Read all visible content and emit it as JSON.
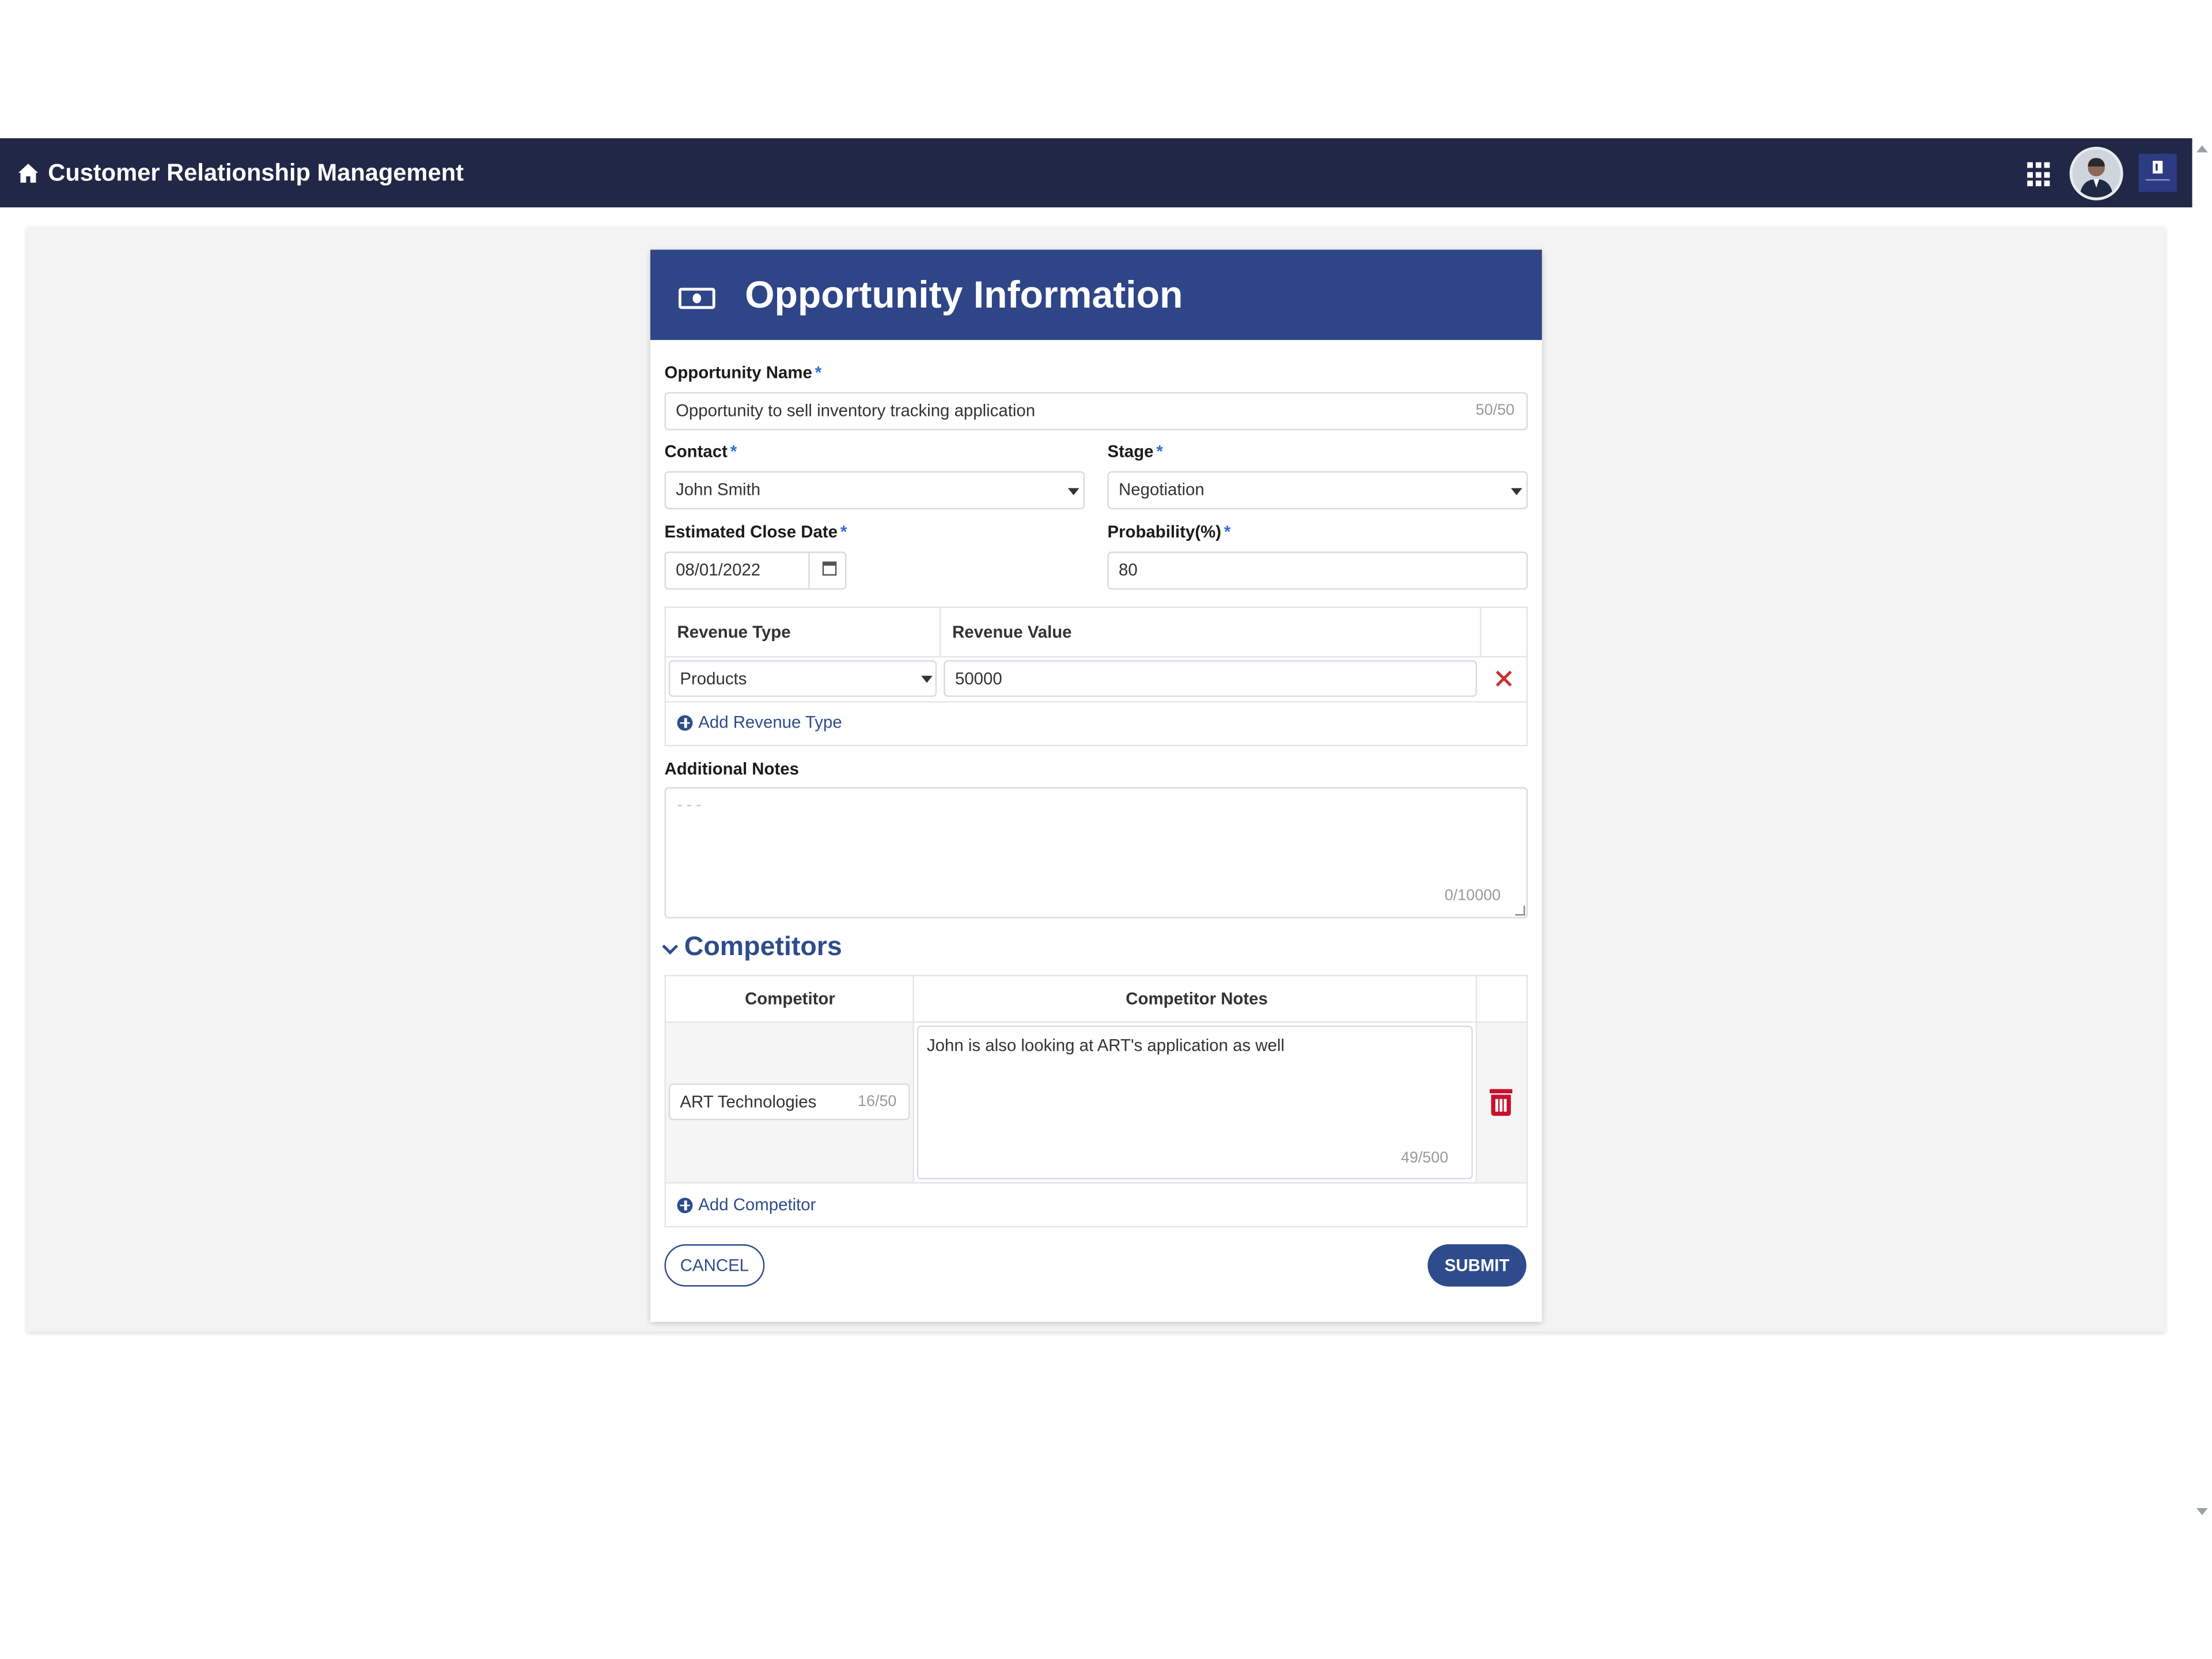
{
  "header": {
    "app_title": "Customer Relationship Management",
    "icons": [
      "home-icon",
      "apps-grid-icon",
      "user-avatar",
      "brand-logo"
    ]
  },
  "form": {
    "title": "Opportunity Information",
    "title_icon": "money-bill-icon",
    "required_marker": "*",
    "opportunity_name": {
      "label": "Opportunity Name",
      "value": "Opportunity to sell inventory tracking application",
      "counter": "50/50"
    },
    "contact": {
      "label": "Contact",
      "value": "John Smith"
    },
    "stage": {
      "label": "Stage",
      "value": "Negotiation"
    },
    "close_date": {
      "label": "Estimated Close Date",
      "value": "08/01/2022"
    },
    "probability": {
      "label": "Probability(%)",
      "value": "80"
    },
    "revenue": {
      "headers": [
        "Revenue Type",
        "Revenue Value"
      ],
      "rows": [
        {
          "type": "Products",
          "value": "50000"
        }
      ],
      "add_label": "Add Revenue Type"
    },
    "notes": {
      "label": "Additional Notes",
      "placeholder": "- - -",
      "counter": "0/10000"
    },
    "competitors": {
      "title": "Competitors",
      "headers": [
        "Competitor",
        "Competitor Notes"
      ],
      "rows": [
        {
          "name": "ART Technologies",
          "name_counter": "16/50",
          "notes": "John is also looking at ART's application as well",
          "notes_counter": "49/500"
        }
      ],
      "add_label": "Add Competitor"
    },
    "cancel_label": "CANCEL",
    "submit_label": "SUBMIT"
  },
  "colors": {
    "topbar": "#212746",
    "card_header": "#2e4588",
    "accent": "#2e4c8c",
    "delete": "#c8102e"
  }
}
